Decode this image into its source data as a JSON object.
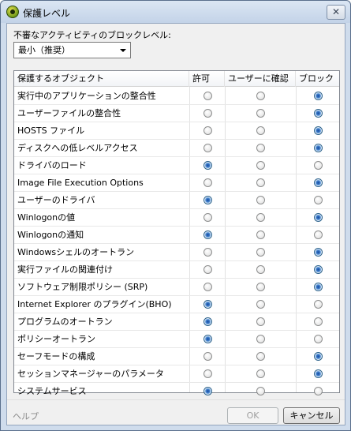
{
  "window": {
    "title": "保護レベル",
    "close_glyph": "✕"
  },
  "prompt": "不審なアクティビティのブロックレベル:",
  "level_select": {
    "value": "最小（推奨）"
  },
  "table": {
    "headers": {
      "name": "保護するオブジェクト",
      "allow": "許可",
      "confirm": "ユーザーに確認",
      "block": "ブロック"
    },
    "rows": [
      {
        "name": "実行中のアプリケーションの整合性",
        "selected": "block"
      },
      {
        "name": "ユーザーファイルの整合性",
        "selected": "block"
      },
      {
        "name": "HOSTS ファイル",
        "selected": "block"
      },
      {
        "name": "ディスクへの低レベルアクセス",
        "selected": "block"
      },
      {
        "name": "ドライバのロード",
        "selected": "allow"
      },
      {
        "name": "Image File Execution Options",
        "selected": "block"
      },
      {
        "name": "ユーザーのドライバ",
        "selected": "allow"
      },
      {
        "name": "Winlogonの値",
        "selected": "block"
      },
      {
        "name": "Winlogonの通知",
        "selected": "allow"
      },
      {
        "name": "Windowsシェルのオートラン",
        "selected": "block"
      },
      {
        "name": "実行ファイルの関連付け",
        "selected": "block"
      },
      {
        "name": "ソフトウェア制限ポリシー (SRP)",
        "selected": "block"
      },
      {
        "name": "Internet Explorer のプラグイン(BHO)",
        "selected": "allow"
      },
      {
        "name": "プログラムのオートラン",
        "selected": "allow"
      },
      {
        "name": "ポリシーオートラン",
        "selected": "allow"
      },
      {
        "name": "セーフモードの構成",
        "selected": "block"
      },
      {
        "name": "セッションマネージャーのパラメータ",
        "selected": "block"
      },
      {
        "name": "システムサービス",
        "selected": "allow"
      }
    ]
  },
  "footer": {
    "help": "ヘルプ",
    "ok": "OK",
    "cancel": "キャンセル"
  }
}
